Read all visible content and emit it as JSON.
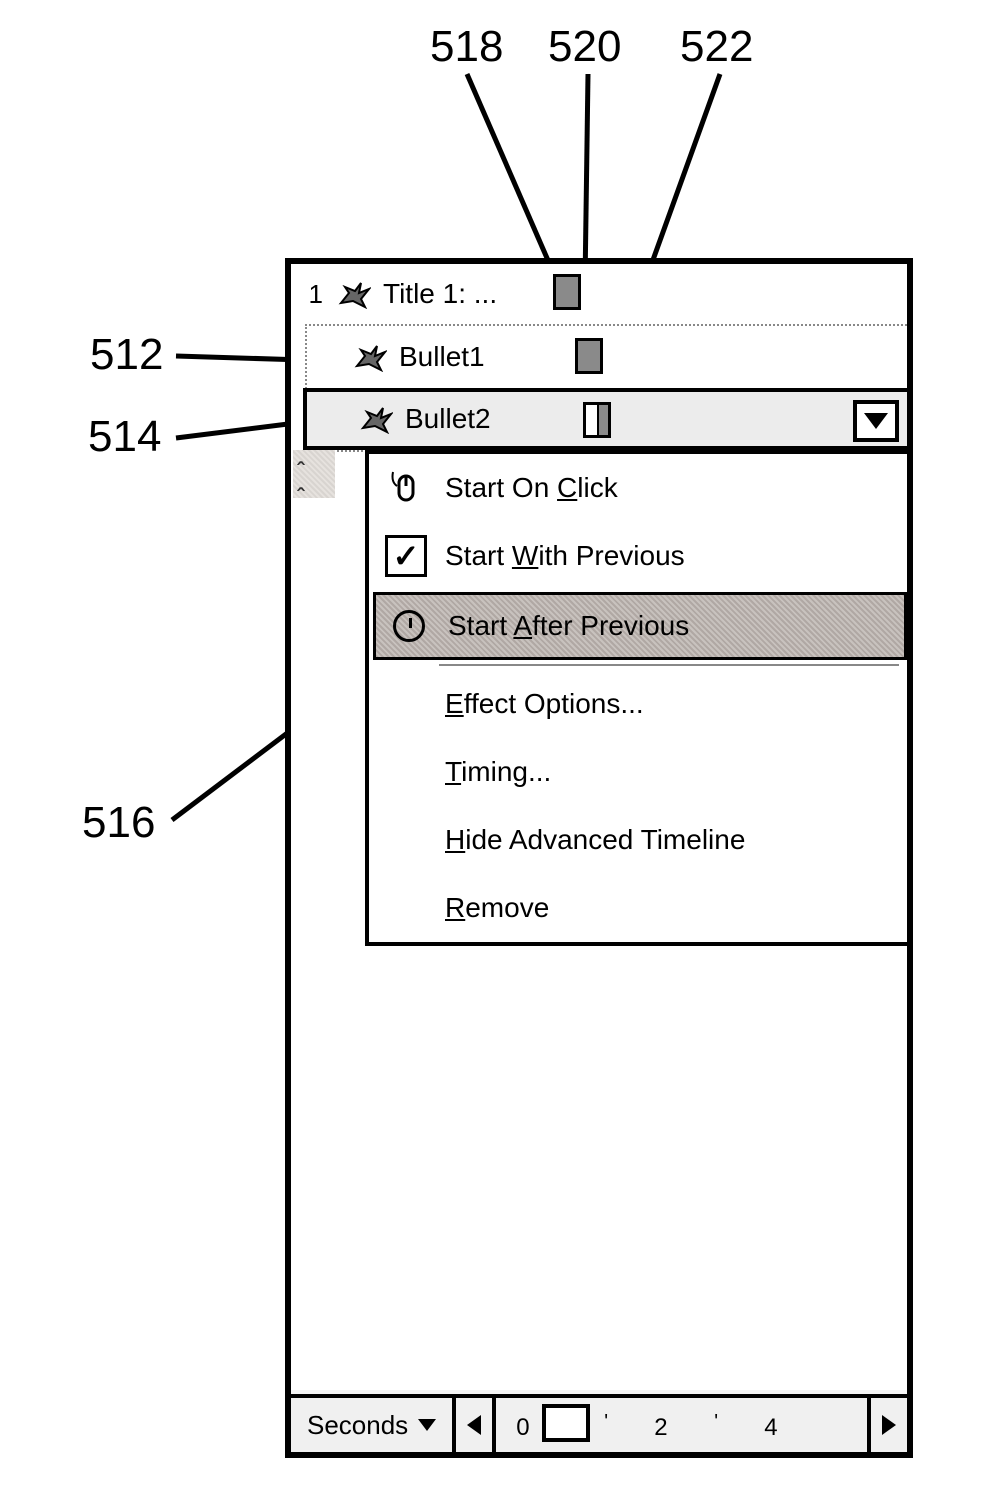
{
  "callouts": {
    "c518": "518",
    "c520": "520",
    "c522": "522",
    "c512": "512",
    "c514": "514",
    "c516": "516"
  },
  "list": {
    "row1_index": "1",
    "row1_text": "Title 1: ...",
    "row2_text": "Bullet1",
    "row3_text": "Bullet2"
  },
  "menu": {
    "start_on_click_pre": "Start On ",
    "start_on_click_accel": "C",
    "start_on_click_post": "lick",
    "start_with_prev_pre": "Start ",
    "start_with_prev_accel": "W",
    "start_with_prev_post": "ith Previous",
    "start_after_prev_pre": "Start ",
    "start_after_prev_accel": "A",
    "start_after_prev_post": "fter Previous",
    "effect_options_accel": "E",
    "effect_options_post": "ffect Options...",
    "timing_accel": "T",
    "timing_post": "iming...",
    "hide_timeline_accel": "H",
    "hide_timeline_post": "ide Advanced Timeline",
    "remove_accel": "R",
    "remove_post": "emove"
  },
  "footer": {
    "seconds_label": "Seconds",
    "tick0": "0",
    "tick2": "2",
    "tick4": "4"
  }
}
